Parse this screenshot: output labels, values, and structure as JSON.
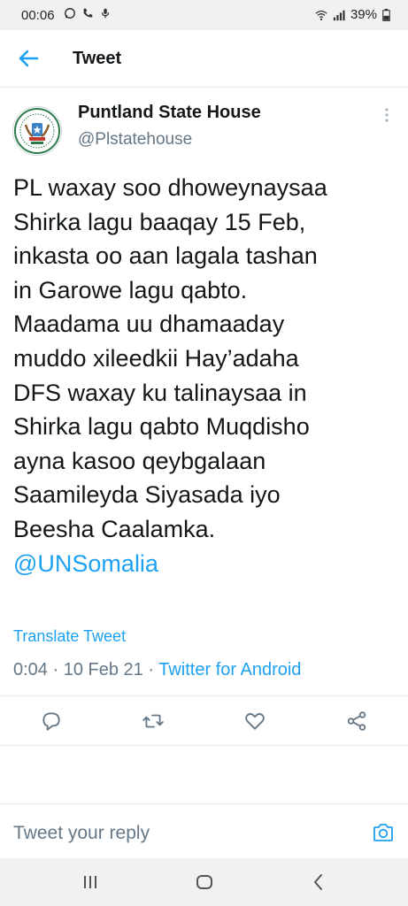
{
  "status_bar": {
    "time": "00:06",
    "battery": "39%",
    "left_icons": [
      "whatsapp-icon",
      "phone-icon",
      "cast-icon"
    ],
    "right_icons": [
      "wifi-icon",
      "signal-icon",
      "battery-icon"
    ]
  },
  "app_bar": {
    "title": "Tweet",
    "back_icon": "arrow-left-icon"
  },
  "author": {
    "name": "Puntland State House",
    "handle": "@Plstatehouse"
  },
  "tweet": {
    "lines": [
      "PL waxay soo dhoweynaysaa",
      "Shirka lagu baaqay 15 Feb,",
      "inkasta oo aan lagala tashan",
      "in Garowe lagu qabto.",
      "Maadama uu dhamaaday",
      "muddo xileedkii Hay’adaha",
      "DFS waxay ku talinaysaa in",
      "Shirka lagu qabto Muqdisho",
      "ayna kasoo qeybgalaan",
      "Saamileyda Siyasada iyo",
      "Beesha Caalamka."
    ],
    "mention": "@UNSomalia",
    "translate_label": "Translate Tweet",
    "time": "0:04",
    "date": "10 Feb 21",
    "separator": "·",
    "source": "Twitter for Android"
  },
  "actions": [
    "reply-icon",
    "retweet-icon",
    "like-icon",
    "share-icon"
  ],
  "reply_bar": {
    "placeholder": "Tweet your reply"
  },
  "colors": {
    "accent": "#1da1f2",
    "secondary_text": "#657786",
    "primary_text": "#14171a"
  }
}
